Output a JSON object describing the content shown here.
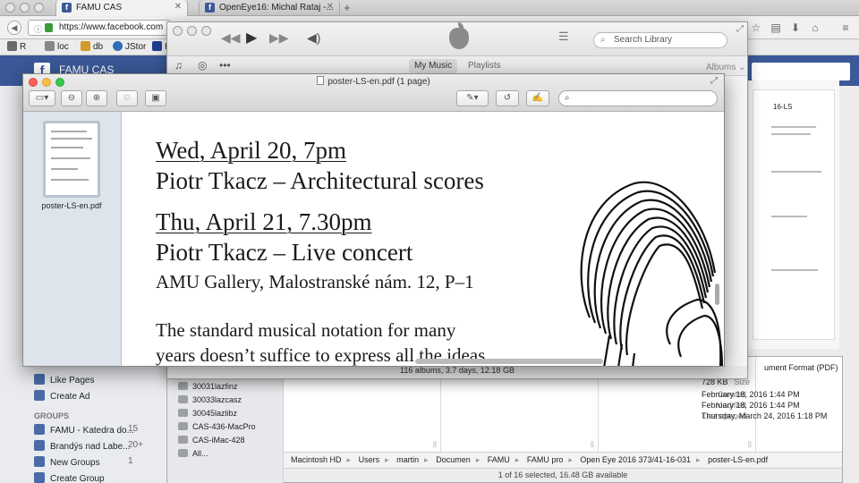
{
  "browser": {
    "tabs": [
      {
        "label": "FAMU CAS",
        "active": true
      },
      {
        "label": "OpenEye16: Michal Rataj -...",
        "active": false
      }
    ],
    "new_tab": "+",
    "url": "https://www.facebook.com",
    "bookmarks": [
      {
        "label": "R",
        "color": "#6a6a6a"
      },
      {
        "label": "loc",
        "color": "#888888"
      },
      {
        "label": "db",
        "color": "#d19a2a"
      },
      {
        "label": "JStor",
        "color": "#2f6db5"
      },
      {
        "label": "H",
        "color": "#1d3f8f"
      }
    ]
  },
  "facebook": {
    "page_name": "FAMU CAS",
    "sidebar_items": [
      {
        "label": "Like Pages",
        "count": ""
      },
      {
        "label": "Create Ad",
        "count": ""
      }
    ],
    "groups_header": "GROUPS",
    "groups": [
      {
        "label": "FAMU - Katedra do...",
        "count": "15"
      },
      {
        "label": "Brandýs nad Labe...",
        "count": "20+"
      },
      {
        "label": "New Groups",
        "count": "1"
      },
      {
        "label": "Create Group",
        "count": ""
      }
    ]
  },
  "itunes": {
    "search_placeholder": "Search Library",
    "tabs": [
      "My Music",
      "Playlists"
    ],
    "albums_menu": "Albums",
    "status": "116 albums, 3.7 days, 12.18 GB"
  },
  "finder": {
    "sidebar_items": [
      "30031lazfinz",
      "30033lazcasz",
      "30045lazlibz",
      "CAS-436-MacPro",
      "CAS-iMac-428",
      "All..."
    ],
    "meta": [
      {
        "key": "Size",
        "value": "728 KB"
      },
      {
        "key": "Created",
        "value": "February 18, 2016 1:44 PM"
      },
      {
        "key": "Modified",
        "value": "February 18, 2016 1:44 PM"
      },
      {
        "key": "Last opened",
        "value": "Thursday, March 24, 2016 1:18 PM"
      }
    ],
    "kind_fragment": "ument Format (PDF)",
    "path": [
      "Macintosh HD",
      "Users",
      "martin",
      "Documen",
      "FAMU",
      "FAMU pro",
      "Open Eye 2016 373/41-16-031",
      "poster-LS-en.pdf"
    ],
    "status": "1 of 16 selected, 16.48 GB available",
    "back_page_title": "16-LS"
  },
  "preview": {
    "title": "poster-LS-en.pdf (1 page)",
    "thumb_caption": "poster-LS-en.pdf",
    "lines": [
      {
        "text": "Wed, April 20, 7pm",
        "underline": true
      },
      {
        "text": "Piotr Tkacz – Architectural scores",
        "underline": false
      },
      {
        "text": "Thu, April 21, 7.30pm",
        "underline": true
      },
      {
        "text": "Piotr Tkacz – Live concert",
        "underline": false
      },
      {
        "text": "AMU Gallery, Malostranské nám. 12, P–1",
        "underline": false
      },
      {
        "text": "The standard musical notation for many",
        "underline": false
      },
      {
        "text": "years doesn’t suffice to express all the ideas",
        "underline": false
      }
    ]
  },
  "colors": {
    "facebook_blue": "#3b5998",
    "close_red": "#fc605c",
    "minimize_yellow": "#fdbc40",
    "zoom_green": "#34c84a"
  }
}
